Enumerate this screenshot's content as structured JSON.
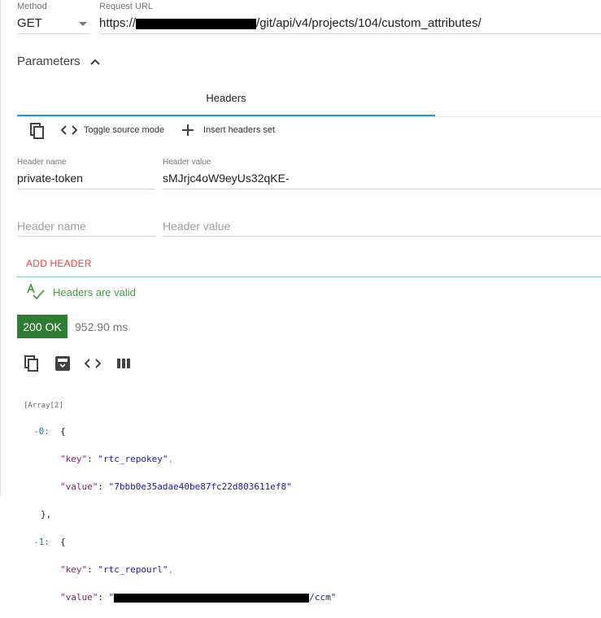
{
  "request": {
    "method_label": "Method",
    "method_value": "GET",
    "url_label": "Request URL",
    "url_prefix": "https://",
    "url_suffix": "/git/api/v4/projects/104/custom_attributes/"
  },
  "parameters": {
    "toggle_label": "Parameters",
    "tab_headers": "Headers",
    "toolbar": {
      "toggle_source_mode": "Toggle source mode",
      "insert_headers_set": "Insert headers set"
    },
    "header_rows": [
      {
        "name_label": "Header name",
        "name_value": "private-token",
        "value_label": "Header value",
        "value_value": "sMJrjc4oW9eyUs32qKE-"
      }
    ],
    "empty_row": {
      "name_placeholder": "Header name",
      "value_placeholder": "Header value"
    },
    "add_header_label": "ADD HEADER",
    "validity_message": "Headers are valid"
  },
  "response": {
    "status_badge": "200 OK",
    "time": "952.90 ms",
    "json_lines": {
      "array_type": "[Array[2]",
      "idx0": "-0:",
      "open0": "{",
      "key0_key": "\"key\"",
      "key0_val": "\"rtc_repokey\"",
      "val0_key": "\"value\"",
      "val0_val": "\"7bbb0e35adae40be87fc22d803611ef8\"",
      "close0": "},",
      "idx1": "-1:",
      "open1": "{",
      "key1_key": "\"key\"",
      "key1_val": "\"rtc_repourl\"",
      "val1_key": "\"value\"",
      "val1_val_suffix": "/ccm\""
    }
  },
  "colors": {
    "accent_blue": "#2196f3",
    "add_header_red": "#f44336",
    "valid_green": "#43a047",
    "status_green": "#2e7d32"
  },
  "icons": [
    "chevron-down-icon",
    "chevron-up-icon",
    "copy-icon",
    "code-icon",
    "plus-icon",
    "spellcheck-icon",
    "save-icon",
    "columns-icon"
  ]
}
